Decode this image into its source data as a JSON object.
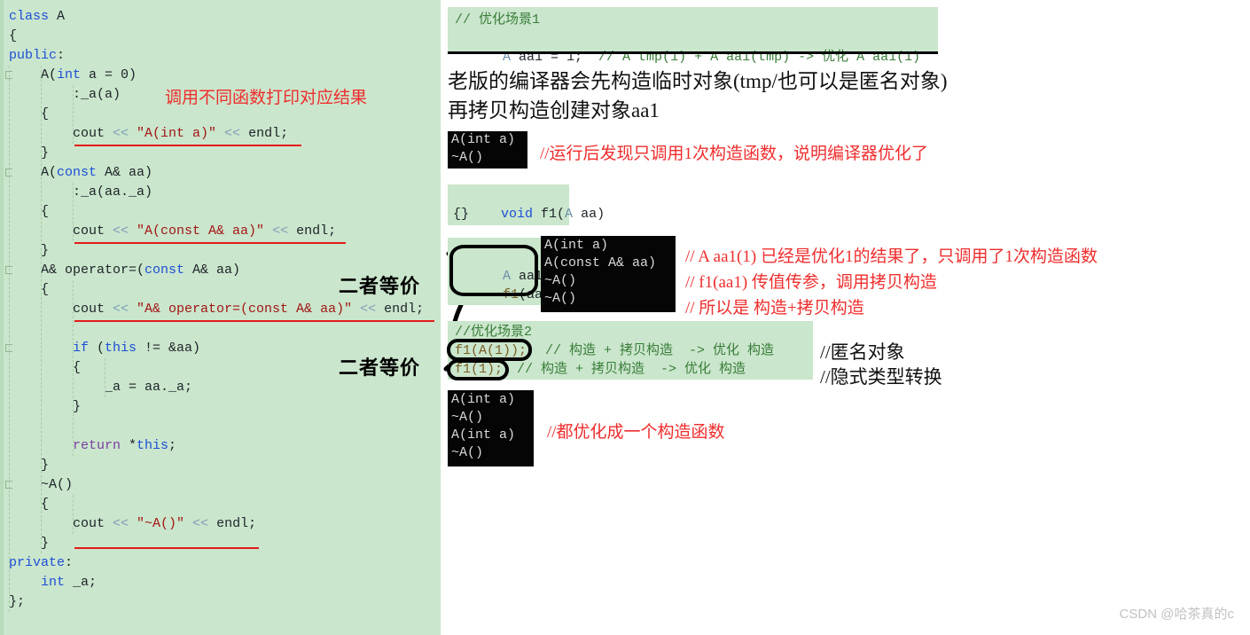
{
  "left_code_panel": {
    "background_color": "#cae6cc",
    "lines": [
      {
        "indent": 0,
        "segments": [
          {
            "t": "class",
            "c": "kw"
          },
          {
            "t": " A",
            "c": "plain"
          }
        ]
      },
      {
        "indent": 0,
        "segments": [
          {
            "t": "{",
            "c": "plain"
          }
        ]
      },
      {
        "indent": 0,
        "segments": [
          {
            "t": "public",
            "c": "kw"
          },
          {
            "t": ":",
            "c": "plain"
          }
        ]
      },
      {
        "indent": 1,
        "segments": [
          {
            "t": "A(",
            "c": "plain"
          },
          {
            "t": "int",
            "c": "kw"
          },
          {
            "t": " a = 0)",
            "c": "plain"
          }
        ]
      },
      {
        "indent": 2,
        "segments": [
          {
            "t": ":_a(a)",
            "c": "plain"
          }
        ]
      },
      {
        "indent": 1,
        "segments": [
          {
            "t": "{",
            "c": "plain"
          }
        ]
      },
      {
        "indent": 2,
        "segments": [
          {
            "t": "cout",
            "c": "plain"
          },
          {
            "t": " << ",
            "c": "op"
          },
          {
            "t": "\"A(int a)\"",
            "c": "str"
          },
          {
            "t": " << ",
            "c": "op"
          },
          {
            "t": "endl",
            "c": "plain"
          },
          {
            "t": ";",
            "c": "plain"
          }
        ]
      },
      {
        "indent": 1,
        "segments": [
          {
            "t": "}",
            "c": "plain"
          }
        ]
      },
      {
        "indent": 1,
        "segments": [
          {
            "t": "A(",
            "c": "plain"
          },
          {
            "t": "const",
            "c": "kw"
          },
          {
            "t": " A& aa)",
            "c": "plain"
          }
        ]
      },
      {
        "indent": 2,
        "segments": [
          {
            "t": ":_a(aa._a)",
            "c": "plain"
          }
        ]
      },
      {
        "indent": 1,
        "segments": [
          {
            "t": "{",
            "c": "plain"
          }
        ]
      },
      {
        "indent": 2,
        "segments": [
          {
            "t": "cout",
            "c": "plain"
          },
          {
            "t": " << ",
            "c": "op"
          },
          {
            "t": "\"A(const A& aa)\"",
            "c": "str"
          },
          {
            "t": " << ",
            "c": "op"
          },
          {
            "t": "endl",
            "c": "plain"
          },
          {
            "t": ";",
            "c": "plain"
          }
        ]
      },
      {
        "indent": 1,
        "segments": [
          {
            "t": "}",
            "c": "plain"
          }
        ]
      },
      {
        "indent": 1,
        "segments": [
          {
            "t": "A& operator=(",
            "c": "plain"
          },
          {
            "t": "const",
            "c": "kw"
          },
          {
            "t": " A& aa)",
            "c": "plain"
          }
        ]
      },
      {
        "indent": 1,
        "segments": [
          {
            "t": "{",
            "c": "plain"
          }
        ]
      },
      {
        "indent": 2,
        "segments": [
          {
            "t": "cout",
            "c": "plain"
          },
          {
            "t": " << ",
            "c": "op"
          },
          {
            "t": "\"A& operator=(const A& aa)\"",
            "c": "str"
          },
          {
            "t": " << ",
            "c": "op"
          },
          {
            "t": "endl",
            "c": "plain"
          },
          {
            "t": ";",
            "c": "plain"
          }
        ]
      },
      {
        "indent": 2,
        "segments": [
          {
            "t": "",
            "c": "plain"
          }
        ]
      },
      {
        "indent": 2,
        "segments": [
          {
            "t": "if",
            "c": "kw"
          },
          {
            "t": " (",
            "c": "plain"
          },
          {
            "t": "this",
            "c": "kw"
          },
          {
            "t": " != &aa)",
            "c": "plain"
          }
        ]
      },
      {
        "indent": 2,
        "segments": [
          {
            "t": "{",
            "c": "plain"
          }
        ]
      },
      {
        "indent": 3,
        "segments": [
          {
            "t": "_a = aa._a;",
            "c": "plain"
          }
        ]
      },
      {
        "indent": 2,
        "segments": [
          {
            "t": "}",
            "c": "plain"
          }
        ]
      },
      {
        "indent": 2,
        "segments": [
          {
            "t": "",
            "c": "plain"
          }
        ]
      },
      {
        "indent": 2,
        "segments": [
          {
            "t": "return",
            "c": "purple"
          },
          {
            "t": " *",
            "c": "plain"
          },
          {
            "t": "this",
            "c": "kw"
          },
          {
            "t": ";",
            "c": "plain"
          }
        ]
      },
      {
        "indent": 1,
        "segments": [
          {
            "t": "}",
            "c": "plain"
          }
        ]
      },
      {
        "indent": 1,
        "segments": [
          {
            "t": "~A()",
            "c": "plain"
          }
        ]
      },
      {
        "indent": 1,
        "segments": [
          {
            "t": "{",
            "c": "plain"
          }
        ]
      },
      {
        "indent": 2,
        "segments": [
          {
            "t": "cout",
            "c": "plain"
          },
          {
            "t": " << ",
            "c": "op"
          },
          {
            "t": "\"~A()\"",
            "c": "str"
          },
          {
            "t": " << ",
            "c": "op"
          },
          {
            "t": "endl",
            "c": "plain"
          },
          {
            "t": ";",
            "c": "plain"
          }
        ]
      },
      {
        "indent": 1,
        "segments": [
          {
            "t": "}",
            "c": "plain"
          }
        ]
      },
      {
        "indent": 0,
        "segments": [
          {
            "t": "private",
            "c": "kw"
          },
          {
            "t": ":",
            "c": "plain"
          }
        ]
      },
      {
        "indent": 1,
        "segments": [
          {
            "t": "int",
            "c": "kw"
          },
          {
            "t": " _a;",
            "c": "plain"
          }
        ]
      },
      {
        "indent": 0,
        "segments": [
          {
            "t": "};",
            "c": "plain"
          }
        ]
      }
    ],
    "annotations": {
      "print_note": "调用不同函数打印对应结果",
      "equivalent_1": "二者等价",
      "equivalent_2": "二者等价"
    }
  },
  "right_panel": {
    "scenario1_block": {
      "line1": "// 优化场景1",
      "line2_parts": [
        {
          "t": "A",
          "c": "type"
        },
        {
          "t": " aa1 = 1;",
          "c": "plain"
        },
        {
          "t": "  // A tmp(1) + A aa1(tmp) -> 优化 A aa1(1)",
          "c": "comment"
        }
      ]
    },
    "explanation": {
      "line1": "老版的编译器会先构造临时对象(tmp/也可以是匿名对象)",
      "line2": "再拷贝构造创建对象aa1"
    },
    "console1": {
      "lines": [
        "A(int a)",
        "~A()"
      ]
    },
    "console1_note": "//运行后发现只调用1次构造函数，说明编译器优化了",
    "f1_block": {
      "line1_parts": [
        {
          "t": "void",
          "c": "kw"
        },
        {
          "t": " f1(",
          "c": "plain"
        },
        {
          "t": "A",
          "c": "type"
        },
        {
          "t": " aa)",
          "c": "plain"
        }
      ],
      "line2": "{}"
    },
    "call_block": {
      "line1_parts": [
        {
          "t": "A",
          "c": "type"
        },
        {
          "t": " aa1(1);",
          "c": "plain"
        }
      ],
      "line2_parts": [
        {
          "t": "f1",
          "c": "fn"
        },
        {
          "t": "(aa1);",
          "c": "plain"
        }
      ]
    },
    "console2": {
      "lines": [
        "A(int a)",
        "A(const A& aa)",
        "~A()",
        "~A()"
      ]
    },
    "console2_notes": [
      "// A aa1(1) 已经是优化1的结果了，只调用了1次构造函数",
      "// f1(aa1) 传值传参，调用拷贝构造",
      "// 所以是 构造+拷贝构造"
    ],
    "scenario2_block": {
      "title": "//优化场景2",
      "row1_code": "f1(A(1));",
      "row1_comment": "// 构造 + 拷贝构造  -> 优化 构造",
      "row2_code": "f1(1);",
      "row2_comment": "// 构造 + 拷贝构造  -> 优化 构造"
    },
    "scenario2_notes": {
      "row1": "//匿名对象",
      "row2": "//隐式类型转换"
    },
    "console3": {
      "lines": [
        "A(int a)",
        "~A()",
        "A(int a)",
        "~A()"
      ]
    },
    "console3_note": "//都优化成一个构造函数"
  },
  "watermark": "CSDN @哈茶真的c",
  "colors": {
    "panel_green": "#cae6cc",
    "console_black": "#050505",
    "annotation_red": "#ef2d2d",
    "underline_red": "#e21b1b",
    "keyword_blue": "#1d4fd8",
    "comment_green": "#3a7d3a",
    "string_red": "#a31515"
  }
}
